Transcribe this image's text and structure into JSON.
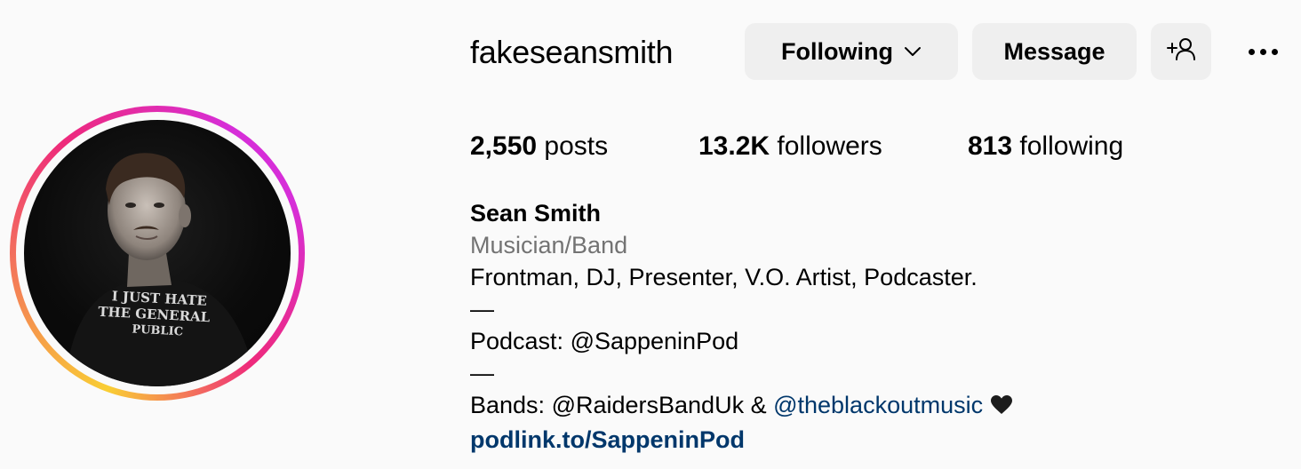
{
  "profile": {
    "username": "fakeseansmith",
    "actions": {
      "following_label": "Following",
      "message_label": "Message",
      "suggest_icon": "person-add-icon",
      "more_icon": "more-horizontal-icon"
    },
    "stats": {
      "posts_count": "2,550",
      "posts_label": "posts",
      "followers_count": "13.2K",
      "followers_label": "followers",
      "following_count": "813",
      "following_label": "following"
    },
    "bio": {
      "name": "Sean Smith",
      "category": "Musician/Band",
      "line1": "Frontman, DJ, Presenter, V.O. Artist, Podcaster.",
      "divider1": "—",
      "podcast_prefix": "Podcast: ",
      "podcast_mention": "@SappeninPod",
      "divider2": "—",
      "bands_prefix": "Bands: ",
      "bands_mention1": "@RaidersBandUk",
      "bands_joiner": " & ",
      "bands_mention2": "@theblackoutmusic",
      "bands_emoji": "black-heart-icon",
      "link": "podlink.to/SappeninPod"
    },
    "avatar": {
      "shirt_text": [
        "I JUST HATE",
        "THE GENERAL",
        "PUBLIC"
      ]
    }
  },
  "colors": {
    "background": "#fafafa",
    "button_bg": "#efefef",
    "link": "#00376b",
    "muted": "#737373",
    "ring_start": "#f9ce34",
    "ring_mid": "#ee2a7b",
    "ring_end": "#d62ed8"
  }
}
